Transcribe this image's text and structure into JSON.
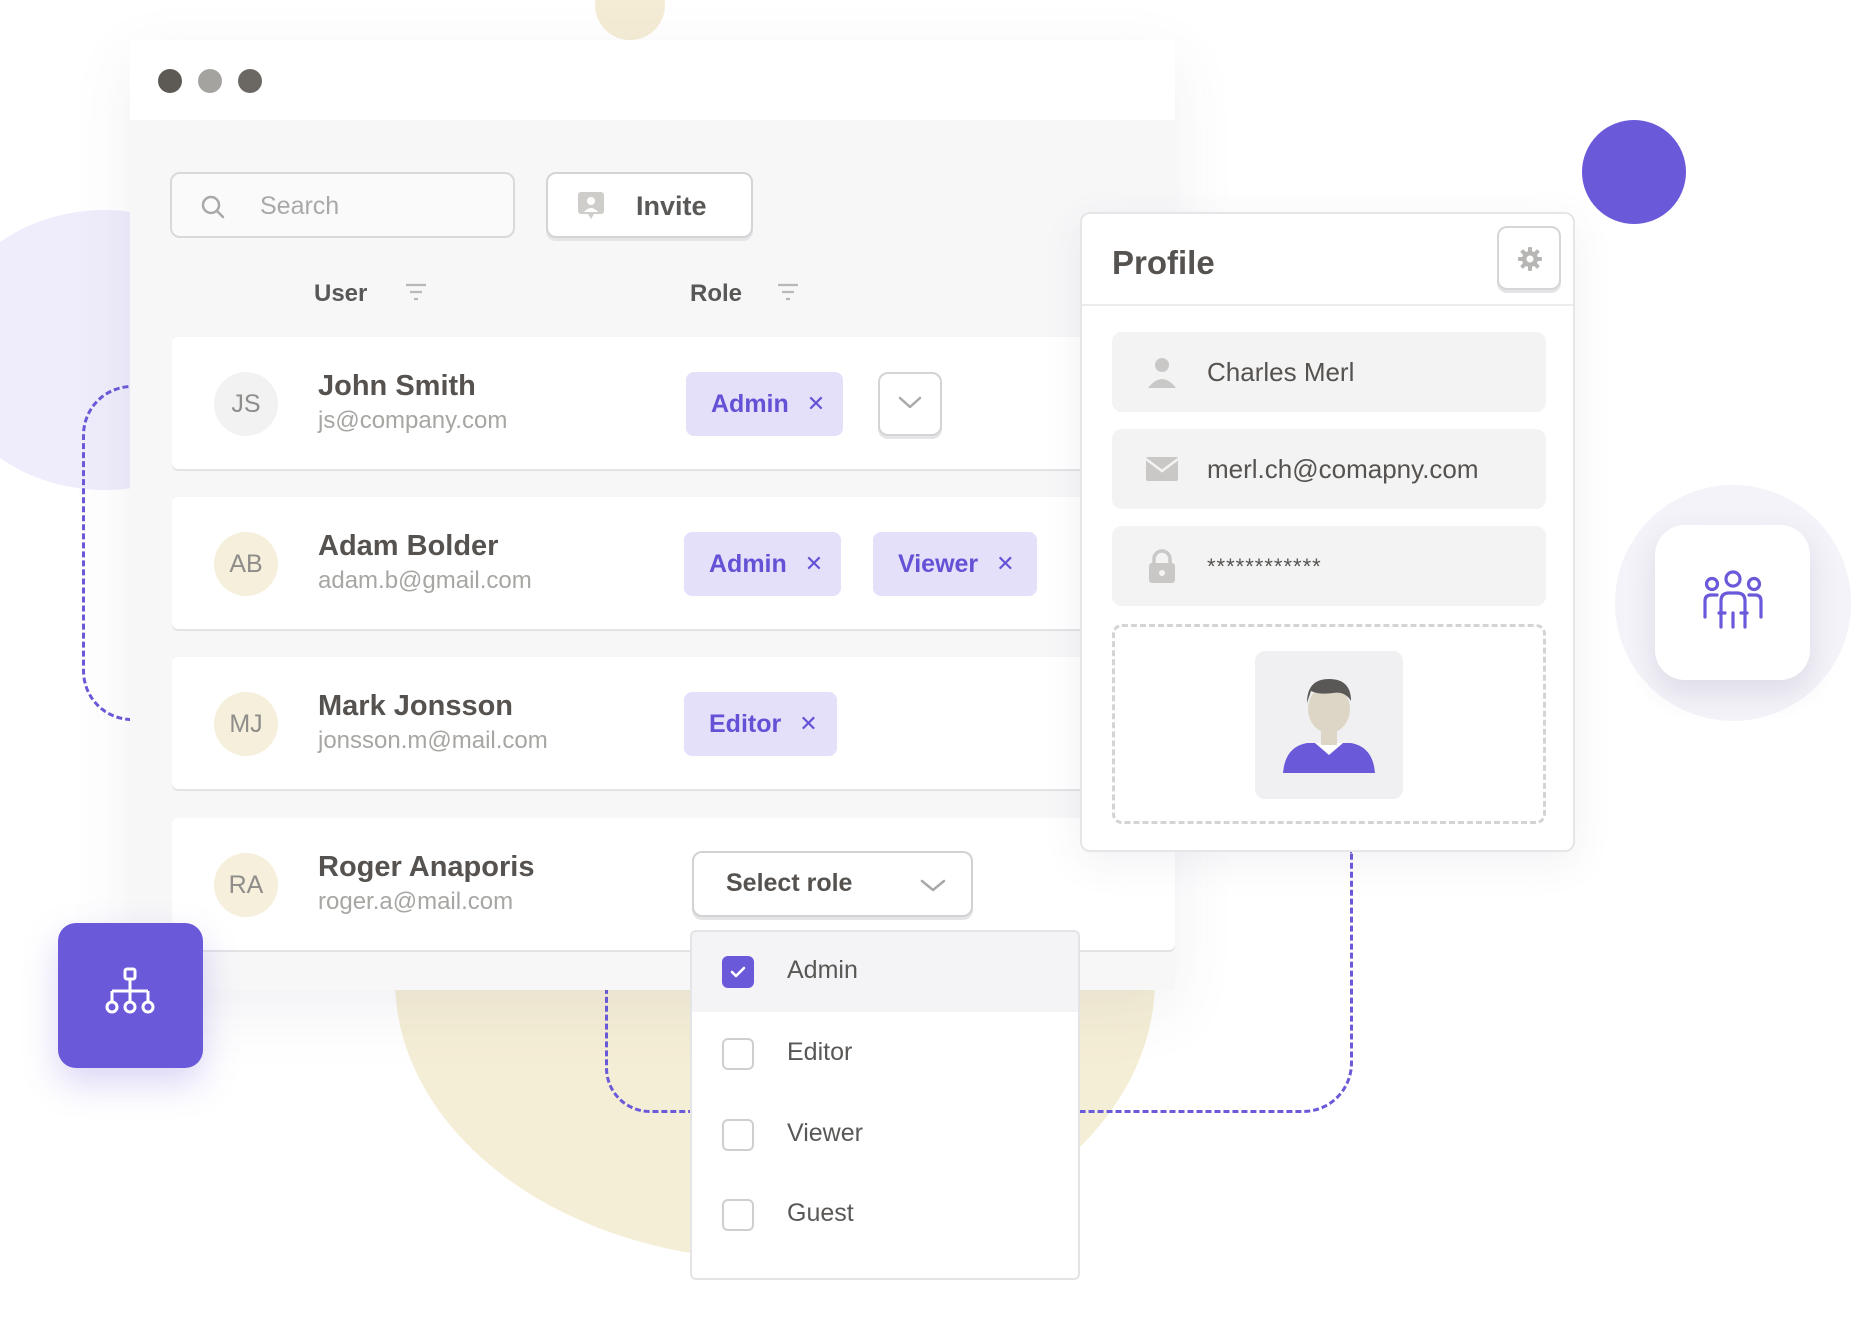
{
  "window": {
    "traffic_lights": [
      {
        "name": "close",
        "color": "#5d5a56"
      },
      {
        "name": "minimize",
        "color": "#a5a3a0"
      },
      {
        "name": "maximize",
        "color": "#6b6864"
      }
    ]
  },
  "toolbar": {
    "search_placeholder": "Search",
    "search_icon": "search-icon",
    "invite_label": "Invite",
    "invite_icon": "user-card-icon"
  },
  "table": {
    "headers": {
      "user": "User",
      "role": "Role"
    },
    "rows": [
      {
        "initials": "JS",
        "avatar_color": "#f2f2f3",
        "name": "John Smith",
        "email": "js@company.com",
        "roles": [
          "Admin"
        ],
        "has_dropdown": true
      },
      {
        "initials": "AB",
        "avatar_color": "#f5efdc",
        "name": "Adam Bolder",
        "email": "adam.b@gmail.com",
        "roles": [
          "Admin",
          "Viewer"
        ]
      },
      {
        "initials": "MJ",
        "avatar_color": "#f5efdc",
        "name": "Mark Jonsson",
        "email": "jonsson.m@mail.com",
        "roles": [
          "Editor"
        ]
      },
      {
        "initials": "RA",
        "avatar_color": "#f5efdc",
        "name": "Roger Anaporis",
        "email": "roger.a@mail.com",
        "roles": []
      }
    ],
    "chip_remove_glyph": "✕"
  },
  "role_select": {
    "label": "Select role",
    "options": [
      {
        "label": "Admin",
        "checked": true
      },
      {
        "label": "Editor",
        "checked": false
      },
      {
        "label": "Viewer",
        "checked": false
      },
      {
        "label": "Guest",
        "checked": false
      }
    ]
  },
  "profile": {
    "title": "Profile",
    "name": "Charles Merl",
    "email": "merl.ch@comapny.com",
    "password_mask": "************",
    "icons": {
      "settings": "gear-icon",
      "name": "person-icon",
      "email": "mail-icon",
      "password": "lock-icon"
    }
  },
  "colors": {
    "accent": "#6a5ad9",
    "chip_bg": "#e5e0fa",
    "chip_text": "#6351d6",
    "lavender": "#efedfb",
    "sand": "#f5eed6"
  }
}
